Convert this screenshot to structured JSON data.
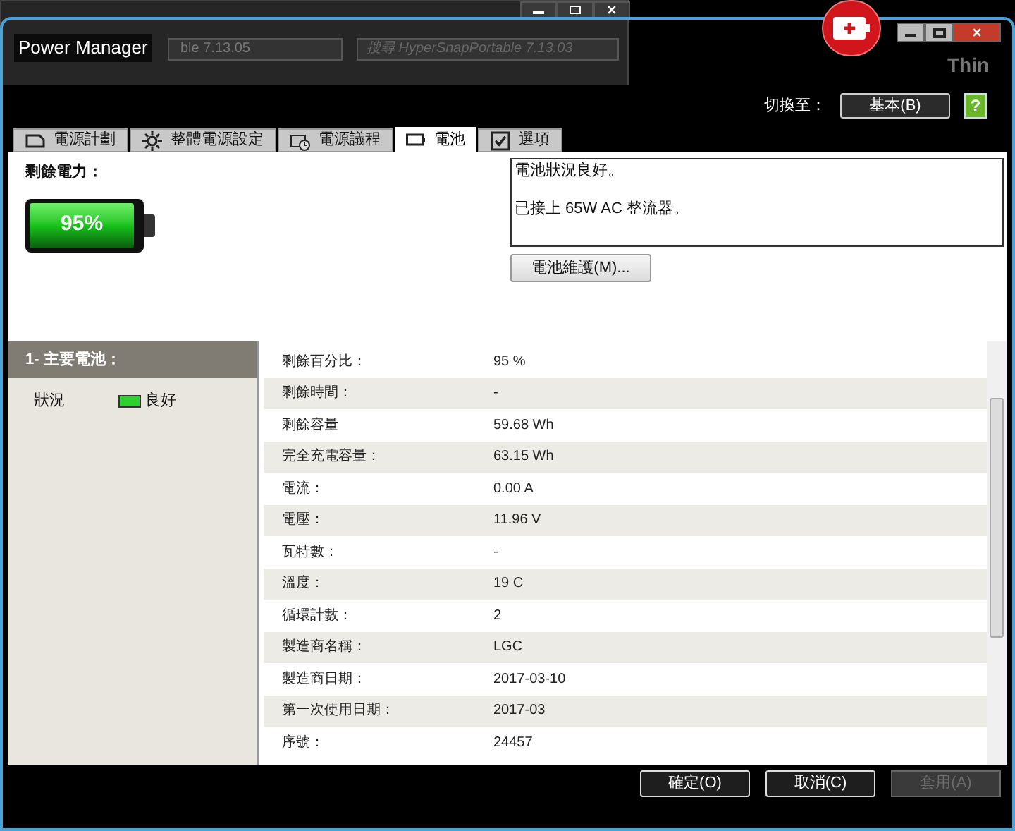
{
  "background_window": {
    "address": "ble 7.13.05",
    "search_placeholder": "搜尋 HyperSnapPortable 7.13.03"
  },
  "desktop_logo": "Thin",
  "window": {
    "title": "Power Manager"
  },
  "switch": {
    "label": "切換至：",
    "button": "基本(B)"
  },
  "help_button": "?",
  "tabs": [
    {
      "label": "電源計劃",
      "selected": false
    },
    {
      "label": "整體電源設定",
      "selected": false
    },
    {
      "label": "電源議程",
      "selected": false
    },
    {
      "label": "電池",
      "selected": true
    },
    {
      "label": "選項",
      "selected": false
    }
  ],
  "charge": {
    "label": "剩餘電力：",
    "level": 0.95,
    "reading": "95%"
  },
  "status_box": {
    "lines": [
      "電池狀況良好。",
      "已接上 65W AC 整流器。"
    ]
  },
  "maintenance_button": "電池維護(M)...",
  "sidebar": {
    "header": "1- 主要電池：",
    "status_label": "狀況",
    "status_value": "良好",
    "status_ok": true
  },
  "details": [
    {
      "label": "剩餘百分比：",
      "value": "95 %"
    },
    {
      "label": "剩餘時間：",
      "value": "-"
    },
    {
      "label": "剩餘容量",
      "value": "59.68 Wh"
    },
    {
      "label": "完全充電容量：",
      "value": "63.15 Wh"
    },
    {
      "label": "電流：",
      "value": "0.00 A"
    },
    {
      "label": "電壓：",
      "value": "11.96 V"
    },
    {
      "label": "瓦特數：",
      "value": "-"
    },
    {
      "label": "溫度：",
      "value": "19 C"
    },
    {
      "label": "循環計數：",
      "value": "2"
    },
    {
      "label": "製造商名稱：",
      "value": "LGC"
    },
    {
      "label": "製造商日期：",
      "value": "2017-03-10"
    },
    {
      "label": "第一次使用日期：",
      "value": "2017-03"
    },
    {
      "label": "序號：",
      "value": "24457"
    }
  ],
  "buttons": [
    {
      "label": "確定(O)",
      "disabled": false
    },
    {
      "label": "取消(C)",
      "disabled": false
    },
    {
      "label": "套用(A)",
      "disabled": true
    }
  ]
}
